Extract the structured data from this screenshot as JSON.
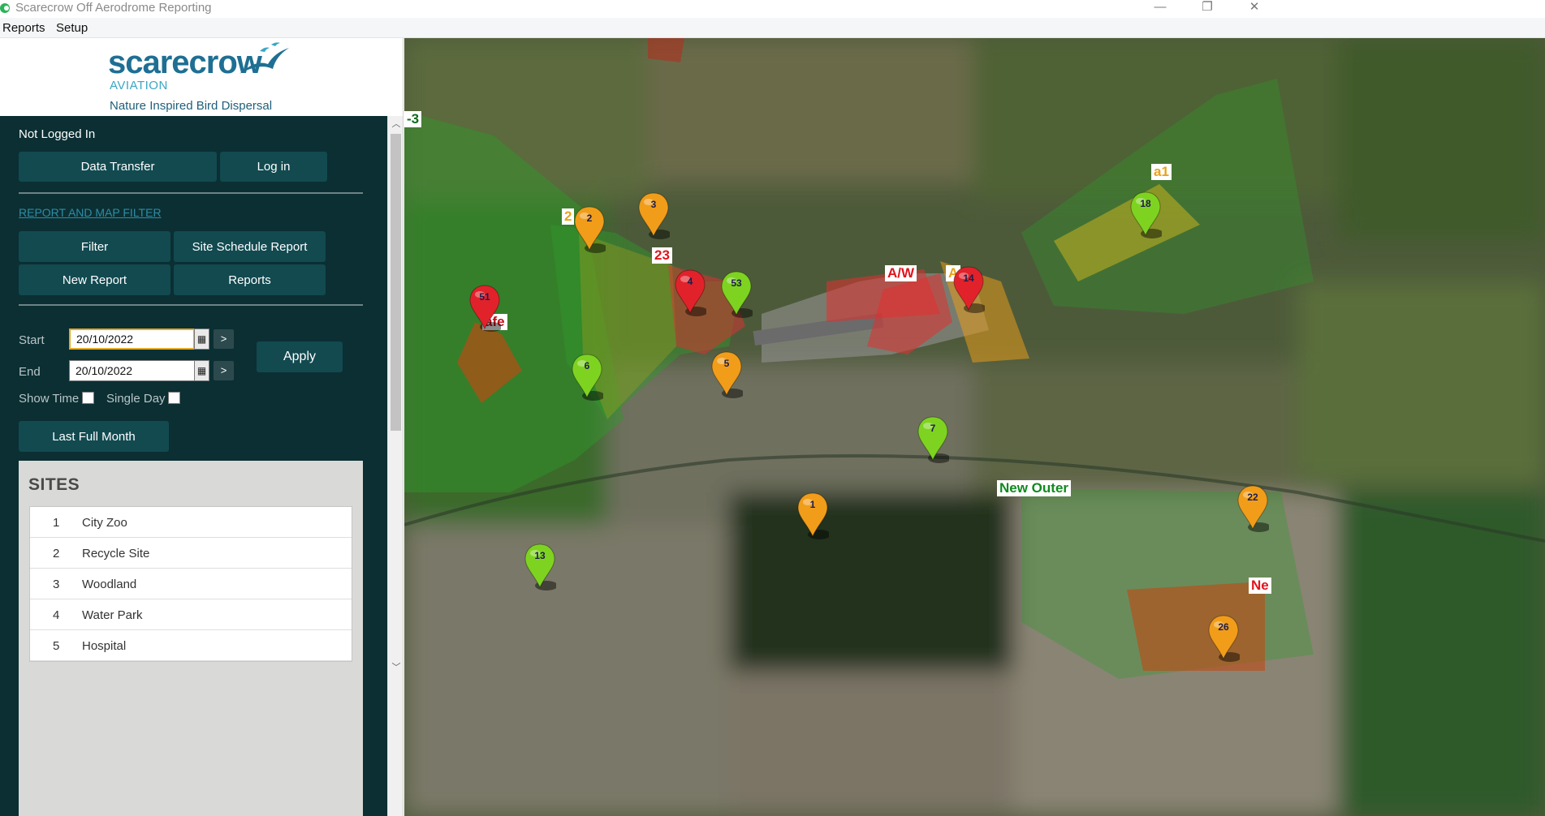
{
  "window": {
    "title": "Scarecrow Off Aerodrome Reporting",
    "controls": [
      "—",
      "❐",
      "✕"
    ]
  },
  "menu": [
    "Reports",
    "Setup"
  ],
  "logo": {
    "word": "scarecrow",
    "sub": "AVIATION",
    "tagline": "Nature Inspired Bird Dispersal"
  },
  "panel": {
    "status": "Not  Logged In",
    "data_transfer": "Data Transfer",
    "log_in": "Log in",
    "filter_link": "REPORT AND MAP FILTER",
    "filter": "Filter",
    "site_schedule": "Site Schedule Report",
    "new_report": "New Report",
    "reports": "Reports",
    "start_label": "Start",
    "end_label": "End",
    "start_value": "20/10/2022",
    "end_value": "20/10/2022",
    "step": ">",
    "apply": "Apply",
    "show_time": "Show Time",
    "single_day": "Single Day",
    "last_full_month": "Last Full Month",
    "sites_title": "SITES",
    "sites": [
      {
        "num": "1",
        "name": "City Zoo"
      },
      {
        "num": "2",
        "name": "Recycle Site"
      },
      {
        "num": "3",
        "name": "Woodland"
      },
      {
        "num": "4",
        "name": "Water Park"
      },
      {
        "num": "5",
        "name": "Hospital"
      }
    ]
  },
  "map": {
    "labels": [
      {
        "text": "-3",
        "color": "#0f6b1a"
      },
      {
        "text": "2",
        "color": "#e8a21a"
      },
      {
        "text": "23",
        "color": "#e0141c"
      },
      {
        "text": "afe",
        "color": "#c0101a"
      },
      {
        "text": "A/W",
        "color": "#e0141c"
      },
      {
        "text": "A",
        "color": "#e8a21a"
      },
      {
        "text": "a1",
        "color": "#e8a21a"
      },
      {
        "text": "New Outer",
        "color": "#0f8a1f"
      },
      {
        "text": "Ne",
        "color": "#e0141c"
      }
    ],
    "pins": [
      {
        "num": "51",
        "color": "red"
      },
      {
        "num": "2",
        "color": "orange"
      },
      {
        "num": "3",
        "color": "orange"
      },
      {
        "num": "4",
        "color": "red"
      },
      {
        "num": "53",
        "color": "green"
      },
      {
        "num": "14",
        "color": "red"
      },
      {
        "num": "18",
        "color": "green"
      },
      {
        "num": "6",
        "color": "green"
      },
      {
        "num": "5",
        "color": "orange"
      },
      {
        "num": "7",
        "color": "green"
      },
      {
        "num": "1",
        "color": "orange"
      },
      {
        "num": "13",
        "color": "green"
      },
      {
        "num": "22",
        "color": "orange"
      },
      {
        "num": "26",
        "color": "orange"
      }
    ],
    "colors": {
      "red": "#e2222b",
      "orange": "#f19d1a",
      "green": "#7ed321"
    }
  }
}
